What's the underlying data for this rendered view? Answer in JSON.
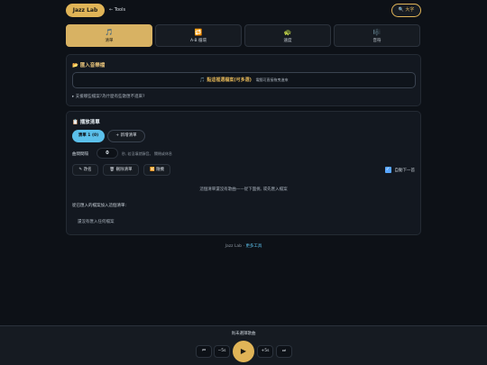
{
  "header": {
    "brand": "Jazz Lab",
    "tools_link": "← Tools",
    "font_button": "🔍 大字"
  },
  "tabs": [
    {
      "icon": "🎵",
      "label": "清單"
    },
    {
      "icon": "🔁",
      "label": "A-B 循環"
    },
    {
      "icon": "🐢",
      "label": "速度"
    },
    {
      "icon": "🎼",
      "label": "音符"
    }
  ],
  "import_panel": {
    "title": "📂 匯入音樂檔",
    "button_main": "🎵 點這裡選檔案(可多選)",
    "button_sub": "電腦可直接拖曳進來",
    "details": "▸ 支援哪些檔案?為什麼有些歌匯不進來?"
  },
  "playlist_panel": {
    "title": "📋 播放清單",
    "list_pill": "清單 1 (0)",
    "add_list": "+ 新增清單",
    "gap_label": "曲間間隔",
    "gap_value": "0",
    "gap_help": "秒, 若沒填就靜音。 關閉或休息",
    "rename": "✎ 改名",
    "delete_list": "🗑 刪除清單",
    "shuffle": "🔀 隨機",
    "autonext": "自動下一首",
    "autonext_checked": true,
    "empty_msg": "這個清單還沒有歌曲——從下面挑, 或先匯入檔案",
    "add_from": "從已匯入的檔案加入這個清單:",
    "no_import": "還沒有匯入任何檔案"
  },
  "footer": {
    "text": "Jazz Lab · ",
    "more": "更多工具"
  },
  "player": {
    "now_playing": "尚未選擇歌曲",
    "prev": "⏮",
    "back5": "−5s",
    "play": "▶",
    "fwd5": "+5s",
    "next": "⏭"
  },
  "colors": {
    "accent": "#e0b457",
    "active_tab": "#d8b263",
    "list_pill": "#5bc0eb",
    "background": "#0d1117"
  }
}
